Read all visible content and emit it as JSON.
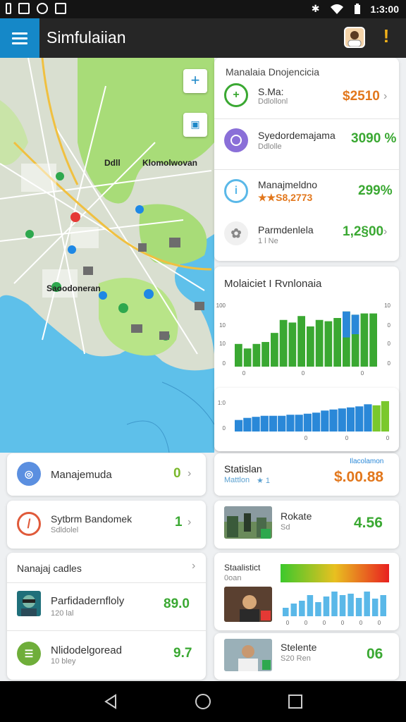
{
  "status": {
    "time": "1:3:00"
  },
  "app": {
    "title": "Simfulaiian"
  },
  "map": {
    "labels": [
      "Ddll",
      "Klomolwovan",
      "Saoodoneran"
    ]
  },
  "mgmt": {
    "title": "Manalaia Dnojencicia",
    "items": [
      {
        "title": "S.Ma:",
        "sub": "Ddlollonl",
        "value": "$2510",
        "color": "#e2771c",
        "icon": "plus-icon"
      },
      {
        "title": "Syedordemajama",
        "sub": "Ddlolle",
        "value": "3090 %",
        "color": "#3aa832",
        "icon": "ring-icon"
      },
      {
        "title": "Manajmeldno",
        "sub": "★★S8,2773",
        "value": "299%",
        "color": "#3aa832",
        "icon": "info-icon"
      },
      {
        "title": "Parmdenlela",
        "sub": "1 l Ne",
        "value": "1,2§00",
        "color": "#3aa832",
        "icon": "flower-icon"
      }
    ]
  },
  "chart1": {
    "title": "Molaiciet I Rvnlonaia"
  },
  "chart_data": [
    {
      "type": "bar",
      "title": "Molaiciet I Rvnlonaia",
      "yticks_left": [
        "100",
        "10",
        "10",
        "0"
      ],
      "yticks_right": [
        "10",
        "0",
        "0",
        "0"
      ],
      "xticks": [
        "0",
        "0",
        "0"
      ],
      "series": [
        {
          "values": [
            35,
            28,
            35,
            38,
            52,
            72,
            68,
            78,
            62,
            72,
            70,
            75,
            85,
            80,
            82,
            82
          ]
        },
        {
          "values": [
            0,
            0,
            0,
            0,
            0,
            0,
            0,
            0,
            0,
            0,
            0,
            0,
            40,
            30,
            0,
            0
          ]
        }
      ],
      "ylim": [
        0,
        100
      ]
    },
    {
      "type": "bar",
      "yticks_left": [
        "1:0",
        "0"
      ],
      "xticks": [
        "0",
        "0",
        "0"
      ],
      "series": [
        {
          "values": [
            22,
            26,
            28,
            30,
            30,
            30,
            32,
            32,
            34,
            36,
            40,
            42,
            44,
            46,
            48,
            52,
            50,
            58
          ]
        },
        {
          "values": [
            0,
            0,
            0,
            0,
            0,
            0,
            0,
            0,
            0,
            0,
            0,
            0,
            0,
            0,
            0,
            0,
            40,
            30
          ]
        }
      ],
      "ylim": [
        0,
        70
      ]
    },
    {
      "type": "bar",
      "title": "Staalistict",
      "xticks": [
        "0",
        "0",
        "0",
        "0",
        "0",
        "0"
      ],
      "values": [
        12,
        18,
        22,
        30,
        20,
        28,
        35,
        30,
        32,
        26,
        35,
        25,
        30
      ],
      "ylim": [
        0,
        40
      ]
    }
  ],
  "left_cards": [
    {
      "title": "Manajemuda",
      "value": "0",
      "color": "#7ab82c"
    },
    {
      "title": "Sytbrm Bandomek",
      "sub": "Sdldolel",
      "value": "1",
      "color": "#3aa832"
    }
  ],
  "left_list": {
    "title": "Nanajaj cadles",
    "items": [
      {
        "title": "Parfidadernfloly",
        "sub": "120 lal",
        "value": "89.0"
      },
      {
        "title": "Nlidodelgoread",
        "sub": "10 bley",
        "value": "9.7"
      }
    ]
  },
  "stat": {
    "title": "Statislan",
    "sub": "Mattlon",
    "sub2": "★ 1",
    "badge": "Ilacolamon",
    "value": "$.00.88"
  },
  "rokate": {
    "title": "Rokate",
    "sub": "Sd",
    "value": "4.56"
  },
  "stat2": {
    "title": "Staalistict",
    "sub": "0oan"
  },
  "stelle": {
    "title": "Stelente",
    "sub": "S20 Ren",
    "value": "06"
  }
}
